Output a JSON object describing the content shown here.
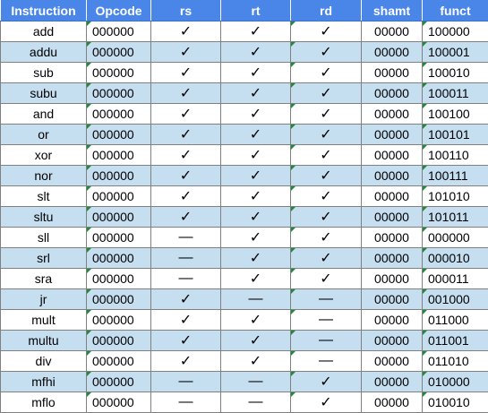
{
  "headers": [
    "Instruction",
    "Opcode",
    "rs",
    "rt",
    "rd",
    "shamt",
    "funct"
  ],
  "symbols": {
    "check": "✓",
    "dash": "—"
  },
  "rows": [
    {
      "instruction": "add",
      "opcode": "000000",
      "rs": "✓",
      "rt": "✓",
      "rd": "✓",
      "shamt": "00000",
      "funct": "100000"
    },
    {
      "instruction": "addu",
      "opcode": "000000",
      "rs": "✓",
      "rt": "✓",
      "rd": "✓",
      "shamt": "00000",
      "funct": "100001"
    },
    {
      "instruction": "sub",
      "opcode": "000000",
      "rs": "✓",
      "rt": "✓",
      "rd": "✓",
      "shamt": "00000",
      "funct": "100010"
    },
    {
      "instruction": "subu",
      "opcode": "000000",
      "rs": "✓",
      "rt": "✓",
      "rd": "✓",
      "shamt": "00000",
      "funct": "100011"
    },
    {
      "instruction": "and",
      "opcode": "000000",
      "rs": "✓",
      "rt": "✓",
      "rd": "✓",
      "shamt": "00000",
      "funct": "100100"
    },
    {
      "instruction": "or",
      "opcode": "000000",
      "rs": "✓",
      "rt": "✓",
      "rd": "✓",
      "shamt": "00000",
      "funct": "100101"
    },
    {
      "instruction": "xor",
      "opcode": "000000",
      "rs": "✓",
      "rt": "✓",
      "rd": "✓",
      "shamt": "00000",
      "funct": "100110"
    },
    {
      "instruction": "nor",
      "opcode": "000000",
      "rs": "✓",
      "rt": "✓",
      "rd": "✓",
      "shamt": "00000",
      "funct": "100111"
    },
    {
      "instruction": "slt",
      "opcode": "000000",
      "rs": "✓",
      "rt": "✓",
      "rd": "✓",
      "shamt": "00000",
      "funct": "101010"
    },
    {
      "instruction": "sltu",
      "opcode": "000000",
      "rs": "✓",
      "rt": "✓",
      "rd": "✓",
      "shamt": "00000",
      "funct": "101011"
    },
    {
      "instruction": "sll",
      "opcode": "000000",
      "rs": "—",
      "rt": "✓",
      "rd": "✓",
      "shamt": "00000",
      "funct": "000000"
    },
    {
      "instruction": "srl",
      "opcode": "000000",
      "rs": "—",
      "rt": "✓",
      "rd": "✓",
      "shamt": "00000",
      "funct": "000010"
    },
    {
      "instruction": "sra",
      "opcode": "000000",
      "rs": "—",
      "rt": "✓",
      "rd": "✓",
      "shamt": "00000",
      "funct": "000011"
    },
    {
      "instruction": "jr",
      "opcode": "000000",
      "rs": "✓",
      "rt": "—",
      "rd": "—",
      "shamt": "00000",
      "funct": "001000"
    },
    {
      "instruction": "mult",
      "opcode": "000000",
      "rs": "✓",
      "rt": "✓",
      "rd": "—",
      "shamt": "00000",
      "funct": "011000"
    },
    {
      "instruction": "multu",
      "opcode": "000000",
      "rs": "✓",
      "rt": "✓",
      "rd": "—",
      "shamt": "00000",
      "funct": "011001"
    },
    {
      "instruction": "div",
      "opcode": "000000",
      "rs": "✓",
      "rt": "✓",
      "rd": "—",
      "shamt": "00000",
      "funct": "011010"
    },
    {
      "instruction": "mfhi",
      "opcode": "000000",
      "rs": "—",
      "rt": "—",
      "rd": "✓",
      "shamt": "00000",
      "funct": "010000"
    },
    {
      "instruction": "mflo",
      "opcode": "000000",
      "rs": "—",
      "rt": "—",
      "rd": "✓",
      "shamt": "00000",
      "funct": "010010"
    }
  ],
  "colors": {
    "header_bg": "#4a86e8",
    "header_text": "#ffffff",
    "band_bg": "#c5def0",
    "flag": "#1e8a3a"
  }
}
